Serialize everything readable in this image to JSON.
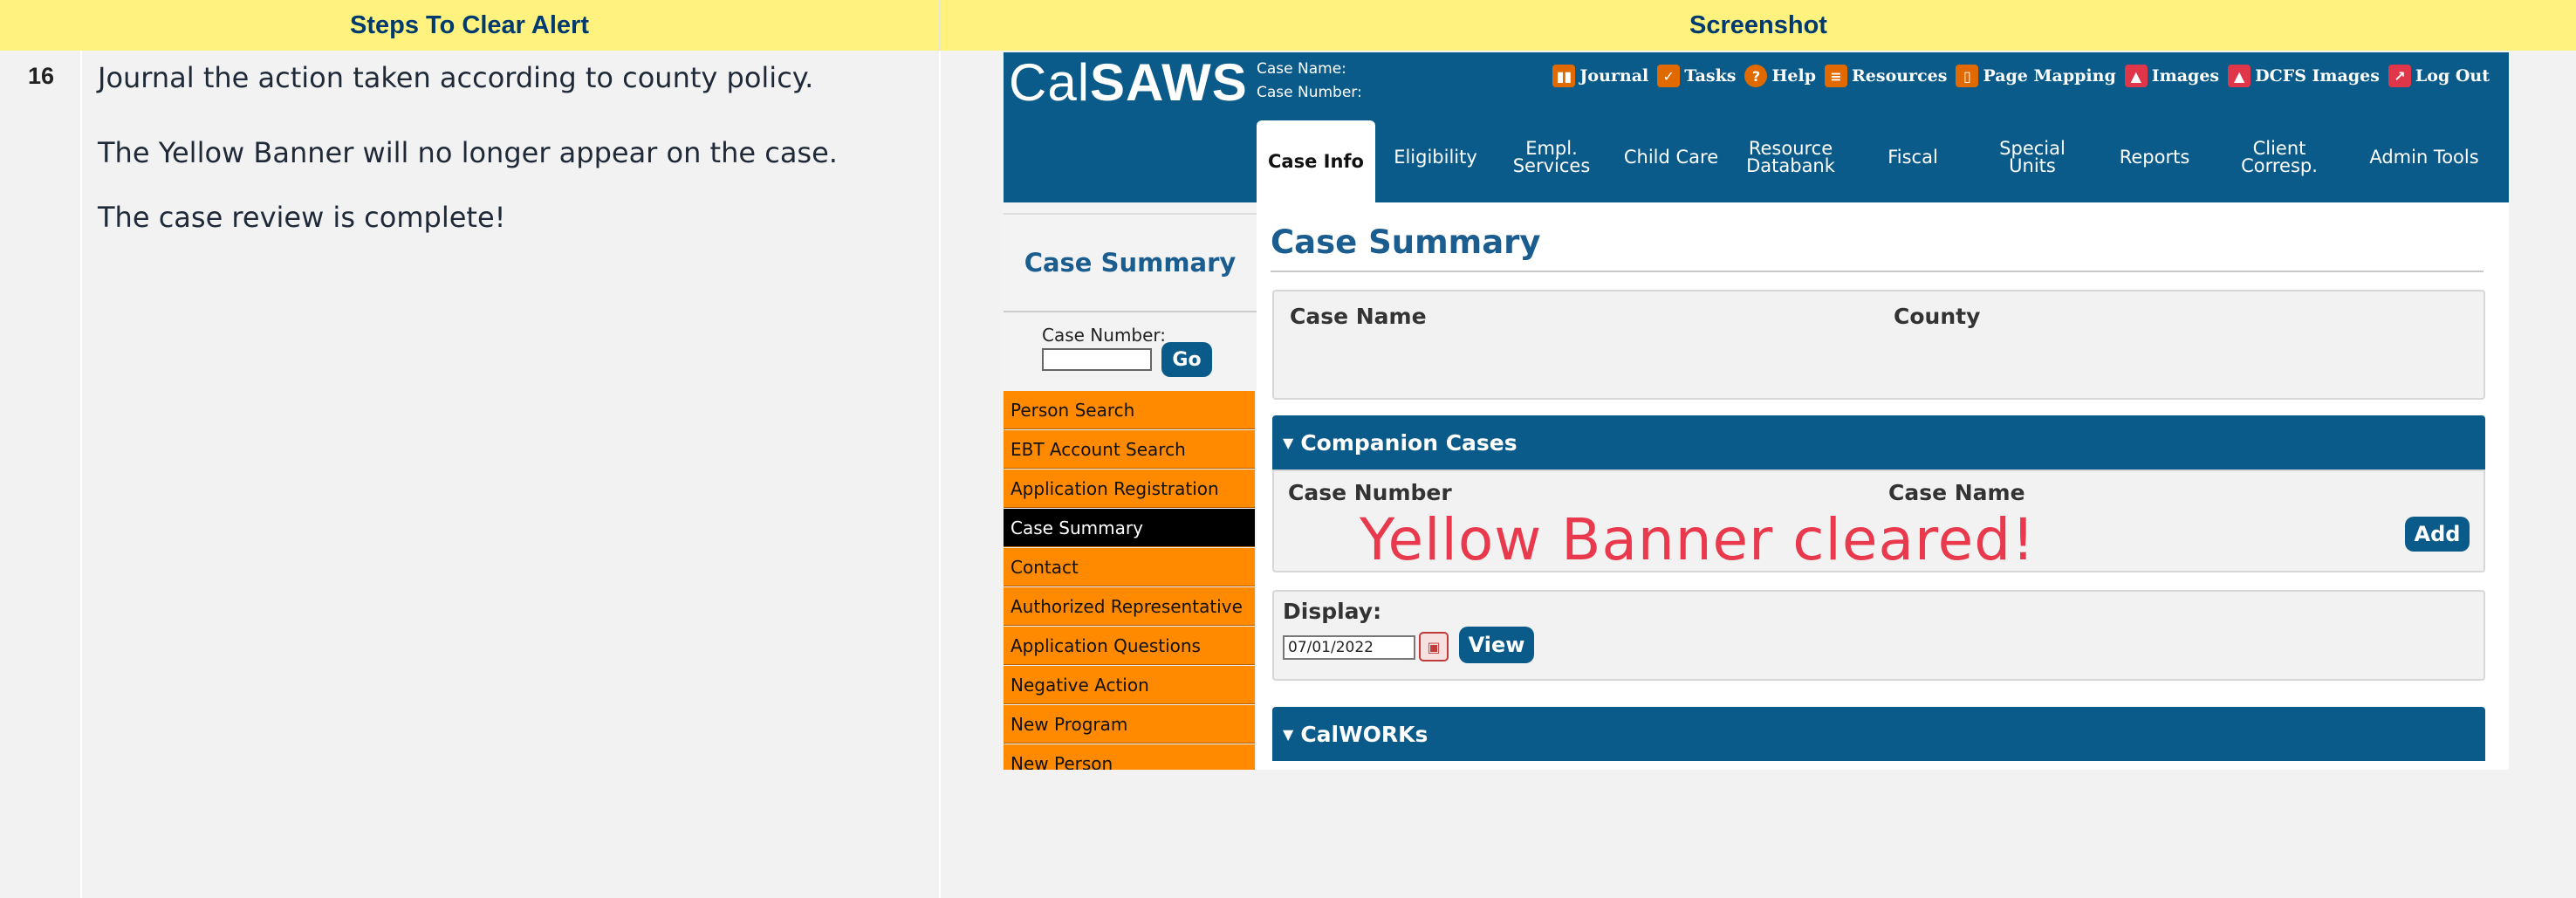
{
  "table": {
    "header_left": "Steps To Clear Alert",
    "header_right": "Screenshot"
  },
  "step": {
    "number": "16",
    "lines": [
      "Journal the action taken according to county policy.",
      "The Yellow Banner will no longer appear on the case.",
      "The case review is complete!"
    ]
  },
  "calsaws": {
    "logo_cal": "Cal",
    "logo_saws": "SAWS",
    "case_name_label": "Case Name:",
    "case_number_label": "Case Number:",
    "top_links": [
      {
        "label": "Journal",
        "icon": "journal-icon",
        "color": "#e06a00"
      },
      {
        "label": "Tasks",
        "icon": "tasks-icon",
        "color": "#e06a00"
      },
      {
        "label": "Help",
        "icon": "help-icon",
        "color": "#e06a00"
      },
      {
        "label": "Resources",
        "icon": "resources-icon",
        "color": "#e06a00"
      },
      {
        "label": "Page Mapping",
        "icon": "page-mapping-icon",
        "color": "#e06a00"
      },
      {
        "label": "Images",
        "icon": "images-icon",
        "color": "#e0364a"
      },
      {
        "label": "DCFS Images",
        "icon": "dcfs-images-icon",
        "color": "#e0364a"
      },
      {
        "label": "Log Out",
        "icon": "logout-icon",
        "color": "#e0364a"
      }
    ],
    "tabs": [
      {
        "label": "Case Info",
        "active": true
      },
      {
        "label": "Eligibility"
      },
      {
        "label": "Empl.\nServices"
      },
      {
        "label": "Child Care"
      },
      {
        "label": "Resource\nDatabank"
      },
      {
        "label": "Fiscal"
      },
      {
        "label": "Special\nUnits"
      },
      {
        "label": "Reports"
      },
      {
        "label": "Client\nCorresp."
      },
      {
        "label": "Admin Tools"
      }
    ],
    "sidebar": {
      "title": "Case Summary",
      "case_number_label": "Case Number:",
      "go_label": "Go",
      "items": [
        "Person Search",
        "EBT Account Search",
        "Application Registration",
        "Case Summary",
        "Contact",
        "Authorized Representative",
        "Application Questions",
        "Negative Action",
        "New Program",
        "New Person"
      ],
      "active_item": "Case Summary"
    },
    "main": {
      "title": "Case Summary",
      "case_name_label": "Case Name",
      "county_label": "County",
      "companion_title": "Companion Cases",
      "companion_col1": "Case Number",
      "companion_col2": "Case Name",
      "add_label": "Add",
      "display_label": "Display:",
      "display_date": "07/01/2022",
      "view_label": "View",
      "calworks_title": "CalWORKs"
    },
    "annotation": "Yellow Banner cleared!"
  },
  "colors": {
    "header_yellow": "#fff27f",
    "calsaws_blue": "#0b5b8a",
    "sidebar_orange": "#ff8a00",
    "annotation_red": "#e8394d"
  }
}
